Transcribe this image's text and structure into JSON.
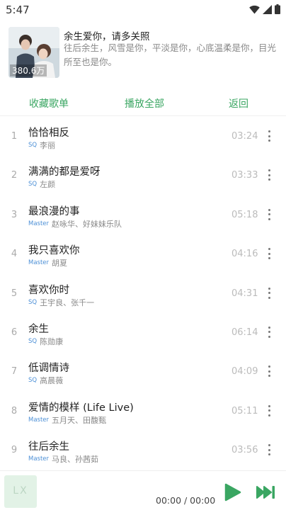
{
  "status_bar": {
    "time": "5:47"
  },
  "playlist": {
    "title": "余生爱你，请多关照",
    "description": "往后余生，风雪是你，平淡是你，心底温柔是你，目光所至也是你。",
    "play_count": "380.6万"
  },
  "actions": {
    "collect": "收藏歌单",
    "play_all": "播放全部",
    "back": "返回"
  },
  "songs": [
    {
      "index": "1",
      "name": "恰恰相反",
      "quality": "SQ",
      "artist": "李丽",
      "duration": "03:24"
    },
    {
      "index": "2",
      "name": "满满的都是爱呀",
      "quality": "SQ",
      "artist": "左颜",
      "duration": "03:33"
    },
    {
      "index": "3",
      "name": "最浪漫的事",
      "quality": "Master",
      "artist": "赵咏华、好妹妹乐队",
      "duration": "05:18"
    },
    {
      "index": "4",
      "name": "我只喜欢你",
      "quality": "Master",
      "artist": "胡夏",
      "duration": "04:16"
    },
    {
      "index": "5",
      "name": "喜欢你时",
      "quality": "SQ",
      "artist": "王宇良、张千一",
      "duration": "04:31"
    },
    {
      "index": "6",
      "name": "余生",
      "quality": "SQ",
      "artist": "陈勋康",
      "duration": "06:14"
    },
    {
      "index": "7",
      "name": "低调情诗",
      "quality": "SQ",
      "artist": "高晨薇",
      "duration": "04:09"
    },
    {
      "index": "8",
      "name": "爱情的模样 (Life Live)",
      "quality": "Master",
      "artist": "五月天、田馥甄",
      "duration": "05:11"
    },
    {
      "index": "9",
      "name": "往后余生",
      "quality": "Master",
      "artist": "马良、孙茜茹",
      "duration": "03:56"
    }
  ],
  "player": {
    "cover_text": "LX",
    "time": "00:00 / 00:00"
  },
  "colors": {
    "accent": "#3aa662",
    "quality": "#4b8fd6"
  },
  "icons": {
    "wifi": "wifi-icon",
    "signal": "signal-icon",
    "battery": "battery-icon",
    "more": "more-vertical-icon",
    "play": "play-icon",
    "next": "skip-next-icon"
  }
}
